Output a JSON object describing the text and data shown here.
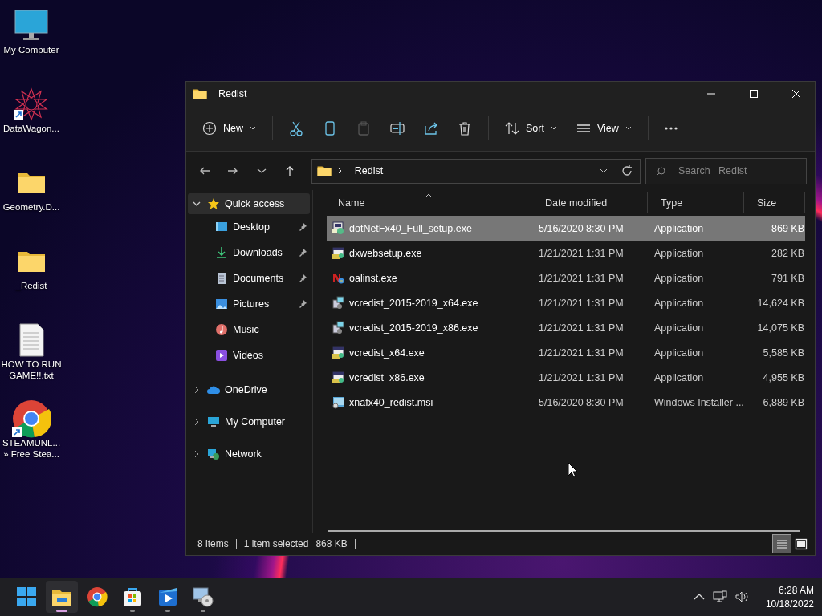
{
  "desktop_icons": [
    {
      "label": "My Computer",
      "kind": "computer",
      "shortcut": false
    },
    {
      "label": "DataWagon...",
      "kind": "star-art",
      "shortcut": true
    },
    {
      "label": "Geometry.D...",
      "kind": "folder",
      "shortcut": false
    },
    {
      "label": "_Redist",
      "kind": "folder",
      "shortcut": false
    },
    {
      "label": "HOW TO RUN GAME!!.txt",
      "kind": "text",
      "shortcut": false
    },
    {
      "label": "STEAMUNL... » Free Stea...",
      "kind": "chrome",
      "shortcut": true
    }
  ],
  "window": {
    "title": "_Redist",
    "toolbar": [
      {
        "kind": "new",
        "label": "New",
        "disabled": false
      },
      {
        "kind": "cut",
        "disabled": false
      },
      {
        "kind": "copy",
        "disabled": false
      },
      {
        "kind": "paste",
        "disabled": true
      },
      {
        "kind": "rename",
        "disabled": false
      },
      {
        "kind": "share",
        "disabled": false
      },
      {
        "kind": "delete",
        "disabled": false
      },
      {
        "kind": "sort",
        "label": "Sort",
        "disabled": false
      },
      {
        "kind": "view",
        "label": "View",
        "disabled": false
      },
      {
        "kind": "more",
        "disabled": false
      }
    ],
    "address": "_Redist",
    "search": {
      "placeholder": "Search _Redist"
    },
    "sidebar": [
      {
        "label": "Quick access",
        "kind": "star",
        "expanded": true,
        "selected": true,
        "children": [
          {
            "label": "Desktop",
            "kind": "desktop",
            "pinned": true,
            "selected": false
          },
          {
            "label": "Downloads",
            "kind": "download",
            "pinned": true,
            "selected": false
          },
          {
            "label": "Documents",
            "kind": "documents",
            "pinned": true,
            "selected": false
          },
          {
            "label": "Pictures",
            "kind": "pictures",
            "pinned": true,
            "selected": false
          },
          {
            "label": "Music",
            "kind": "music",
            "pinned": false,
            "selected": false
          },
          {
            "label": "Videos",
            "kind": "videos",
            "pinned": false,
            "selected": false
          }
        ]
      },
      {
        "label": "OneDrive",
        "kind": "cloud",
        "expanded": false,
        "selected": false
      },
      {
        "label": "My Computer",
        "kind": "computer",
        "expanded": false,
        "selected": false
      },
      {
        "label": "Network",
        "kind": "network",
        "expanded": false,
        "selected": false
      }
    ],
    "columns": [
      {
        "label": "Name",
        "sorted": true
      },
      {
        "label": "Date modified",
        "sorted": false
      },
      {
        "label": "Type",
        "sorted": false
      },
      {
        "label": "Size",
        "sorted": false
      }
    ],
    "files": [
      {
        "name": "dotNetFx40_Full_setup.exe",
        "date": "5/16/2020 8:30 PM",
        "type": "Application",
        "size": "869 KB",
        "kind": "setup",
        "selected": true
      },
      {
        "name": "dxwebsetup.exe",
        "date": "1/21/2021 1:31 PM",
        "type": "Application",
        "size": "282 KB",
        "kind": "app",
        "selected": false
      },
      {
        "name": "oalinst.exe",
        "date": "1/21/2021 1:31 PM",
        "type": "Application",
        "size": "791 KB",
        "kind": "openal",
        "selected": false
      },
      {
        "name": "vcredist_2015-2019_x64.exe",
        "date": "1/21/2021 1:31 PM",
        "type": "Application",
        "size": "14,624 KB",
        "kind": "installer",
        "selected": false
      },
      {
        "name": "vcredist_2015-2019_x86.exe",
        "date": "1/21/2021 1:31 PM",
        "type": "Application",
        "size": "14,075 KB",
        "kind": "installer",
        "selected": false
      },
      {
        "name": "vcredist_x64.exe",
        "date": "1/21/2021 1:31 PM",
        "type": "Application",
        "size": "5,585 KB",
        "kind": "app",
        "selected": false
      },
      {
        "name": "vcredist_x86.exe",
        "date": "1/21/2021 1:31 PM",
        "type": "Application",
        "size": "4,955 KB",
        "kind": "app",
        "selected": false
      },
      {
        "name": "xnafx40_redist.msi",
        "date": "5/16/2020 8:30 PM",
        "type": "Windows Installer ...",
        "size": "6,889 KB",
        "kind": "msi",
        "selected": false
      }
    ],
    "status": {
      "count": "8 items",
      "selection": "1 item selected",
      "selection_size": "868 KB"
    },
    "views": [
      {
        "kind": "details",
        "selected": true
      },
      {
        "kind": "tiles",
        "selected": false
      }
    ]
  },
  "taskbar": {
    "apps": [
      {
        "kind": "start",
        "running": false,
        "active": false
      },
      {
        "kind": "explorer",
        "running": true,
        "active": true
      },
      {
        "kind": "chrome",
        "running": false,
        "active": false
      },
      {
        "kind": "store",
        "running": true,
        "active": false
      },
      {
        "kind": "media",
        "running": true,
        "active": false
      },
      {
        "kind": "setup",
        "running": true,
        "active": false
      }
    ],
    "time": "6:28 AM",
    "date": "10/18/2022"
  }
}
